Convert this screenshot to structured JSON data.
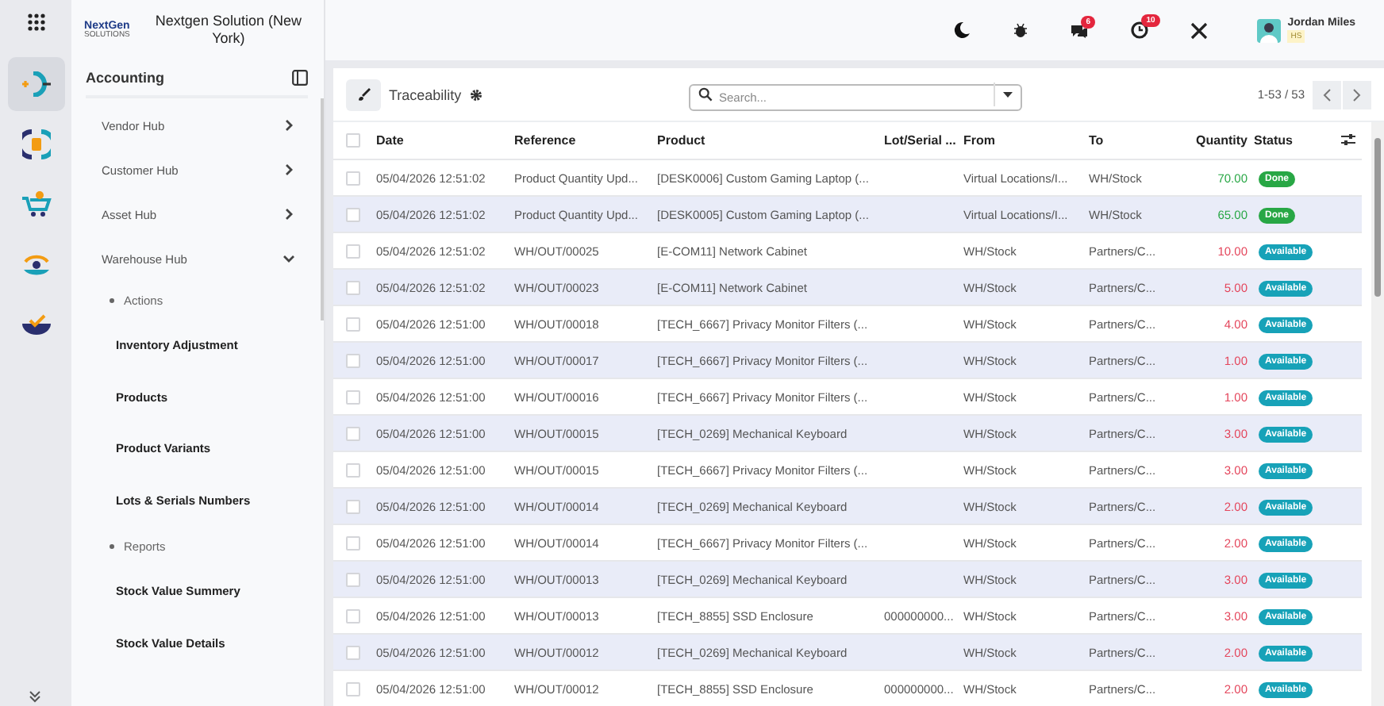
{
  "rail": {
    "items": [
      {
        "kind": "app",
        "selected": true
      },
      {
        "kind": "finance",
        "selected": false
      },
      {
        "kind": "cart",
        "selected": false
      },
      {
        "kind": "eye",
        "selected": false
      },
      {
        "kind": "check",
        "selected": false
      }
    ]
  },
  "company": {
    "name": "Nextgen Solution (New York)",
    "logo_text": "NextGen",
    "logo_sub": "SOLUTIONS"
  },
  "sidebar": {
    "title": "Accounting",
    "items": [
      {
        "label": "Vendor Hub",
        "expanded": false
      },
      {
        "label": "Customer Hub",
        "expanded": false
      },
      {
        "label": "Asset Hub",
        "expanded": false
      },
      {
        "label": "Warehouse Hub",
        "expanded": true,
        "children": [
          {
            "label": "Actions",
            "children": [
              {
                "label": "Inventory Adjustment"
              },
              {
                "label": "Products"
              },
              {
                "label": "Product Variants"
              },
              {
                "label": "Lots & Serials Numbers"
              }
            ]
          },
          {
            "label": "Reports",
            "children": [
              {
                "label": "Stock Value Summery"
              },
              {
                "label": "Stock Value Details"
              }
            ]
          }
        ]
      }
    ]
  },
  "topbar": {
    "messages_badge": "6",
    "activities_badge": "10",
    "user": {
      "name": "Jordan Miles",
      "company": "HS"
    }
  },
  "view": {
    "title": "Traceability",
    "search": {
      "placeholder": "Search..."
    },
    "pager": "1-53 / 53"
  },
  "table": {
    "select_all_checked": false,
    "columns": [
      "Date",
      "Reference",
      "Product",
      "Lot/Serial ...",
      "From",
      "To",
      "Quantity",
      "Status"
    ],
    "rows": [
      {
        "checked": false,
        "date": "05/04/2026 12:51:02",
        "reference": "Product Quantity Upd...",
        "product": "[DESK0006] Custom Gaming Laptop (...",
        "lot": "",
        "from": "Virtual Locations/I...",
        "to": "WH/Stock",
        "quantity": "70.00",
        "status": {
          "kind": "done",
          "label": "Done"
        }
      },
      {
        "checked": false,
        "date": "05/04/2026 12:51:02",
        "reference": "Product Quantity Upd...",
        "product": "[DESK0005] Custom Gaming Laptop (...",
        "lot": "",
        "from": "Virtual Locations/I...",
        "to": "WH/Stock",
        "quantity": "65.00",
        "status": {
          "kind": "done",
          "label": "Done"
        }
      },
      {
        "checked": false,
        "date": "05/04/2026 12:51:02",
        "reference": "WH/OUT/00025",
        "product": "[E-COM11] Network Cabinet",
        "lot": "",
        "from": "WH/Stock",
        "to": "Partners/C...",
        "quantity": "10.00",
        "status": {
          "kind": "available",
          "label": "Available"
        }
      },
      {
        "checked": false,
        "date": "05/04/2026 12:51:02",
        "reference": "WH/OUT/00023",
        "product": "[E-COM11] Network Cabinet",
        "lot": "",
        "from": "WH/Stock",
        "to": "Partners/C...",
        "quantity": "5.00",
        "status": {
          "kind": "available",
          "label": "Available"
        }
      },
      {
        "checked": false,
        "date": "05/04/2026 12:51:00",
        "reference": "WH/OUT/00018",
        "product": "[TECH_6667] Privacy Monitor Filters (...",
        "lot": "",
        "from": "WH/Stock",
        "to": "Partners/C...",
        "quantity": "4.00",
        "status": {
          "kind": "available",
          "label": "Available"
        }
      },
      {
        "checked": false,
        "date": "05/04/2026 12:51:00",
        "reference": "WH/OUT/00017",
        "product": "[TECH_6667] Privacy Monitor Filters (...",
        "lot": "",
        "from": "WH/Stock",
        "to": "Partners/C...",
        "quantity": "1.00",
        "status": {
          "kind": "available",
          "label": "Available"
        }
      },
      {
        "checked": false,
        "date": "05/04/2026 12:51:00",
        "reference": "WH/OUT/00016",
        "product": "[TECH_6667] Privacy Monitor Filters (...",
        "lot": "",
        "from": "WH/Stock",
        "to": "Partners/C...",
        "quantity": "1.00",
        "status": {
          "kind": "available",
          "label": "Available"
        }
      },
      {
        "checked": false,
        "date": "05/04/2026 12:51:00",
        "reference": "WH/OUT/00015",
        "product": "[TECH_0269] Mechanical Keyboard",
        "lot": "",
        "from": "WH/Stock",
        "to": "Partners/C...",
        "quantity": "3.00",
        "status": {
          "kind": "available",
          "label": "Available"
        }
      },
      {
        "checked": false,
        "date": "05/04/2026 12:51:00",
        "reference": "WH/OUT/00015",
        "product": "[TECH_6667] Privacy Monitor Filters (...",
        "lot": "",
        "from": "WH/Stock",
        "to": "Partners/C...",
        "quantity": "3.00",
        "status": {
          "kind": "available",
          "label": "Available"
        }
      },
      {
        "checked": false,
        "date": "05/04/2026 12:51:00",
        "reference": "WH/OUT/00014",
        "product": "[TECH_0269] Mechanical Keyboard",
        "lot": "",
        "from": "WH/Stock",
        "to": "Partners/C...",
        "quantity": "2.00",
        "status": {
          "kind": "available",
          "label": "Available"
        }
      },
      {
        "checked": false,
        "date": "05/04/2026 12:51:00",
        "reference": "WH/OUT/00014",
        "product": "[TECH_6667] Privacy Monitor Filters (...",
        "lot": "",
        "from": "WH/Stock",
        "to": "Partners/C...",
        "quantity": "2.00",
        "status": {
          "kind": "available",
          "label": "Available"
        }
      },
      {
        "checked": false,
        "date": "05/04/2026 12:51:00",
        "reference": "WH/OUT/00013",
        "product": "[TECH_0269] Mechanical Keyboard",
        "lot": "",
        "from": "WH/Stock",
        "to": "Partners/C...",
        "quantity": "3.00",
        "status": {
          "kind": "available",
          "label": "Available"
        }
      },
      {
        "checked": false,
        "date": "05/04/2026 12:51:00",
        "reference": "WH/OUT/00013",
        "product": "[TECH_8855] SSD Enclosure",
        "lot": "000000000...",
        "from": "WH/Stock",
        "to": "Partners/C...",
        "quantity": "3.00",
        "status": {
          "kind": "available",
          "label": "Available"
        }
      },
      {
        "checked": false,
        "date": "05/04/2026 12:51:00",
        "reference": "WH/OUT/00012",
        "product": "[TECH_0269] Mechanical Keyboard",
        "lot": "",
        "from": "WH/Stock",
        "to": "Partners/C...",
        "quantity": "2.00",
        "status": {
          "kind": "available",
          "label": "Available"
        }
      },
      {
        "checked": false,
        "date": "05/04/2026 12:51:00",
        "reference": "WH/OUT/00012",
        "product": "[TECH_8855] SSD Enclosure",
        "lot": "000000000...",
        "from": "WH/Stock",
        "to": "Partners/C...",
        "quantity": "2.00",
        "status": {
          "kind": "available",
          "label": "Available"
        }
      }
    ]
  }
}
